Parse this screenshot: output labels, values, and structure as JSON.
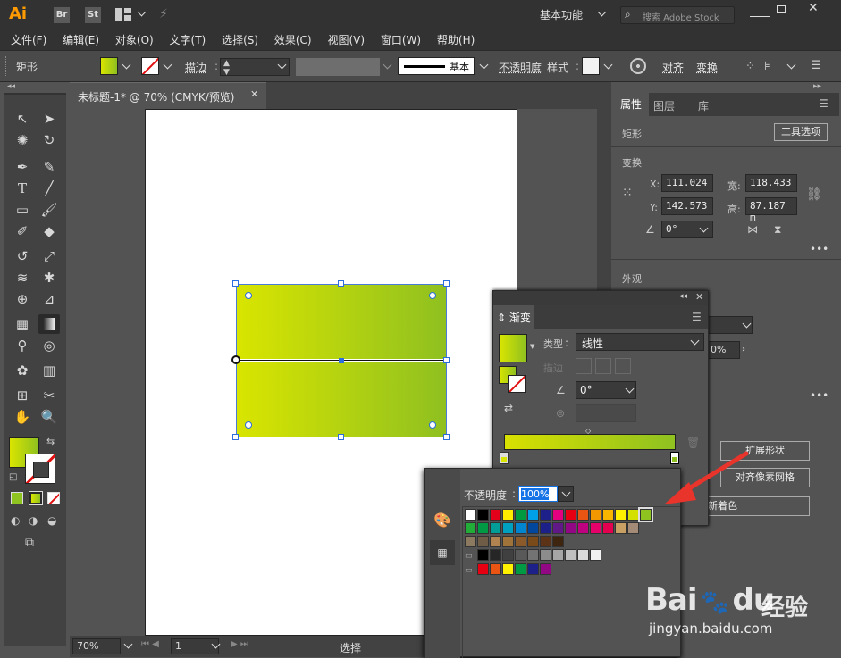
{
  "app": {
    "logo": "Ai",
    "br": "Br",
    "st": "St",
    "workspace": "基本功能",
    "stock_placeholder": "搜索 Adobe Stock"
  },
  "menu": [
    "文件(F)",
    "编辑(E)",
    "对象(O)",
    "文字(T)",
    "选择(S)",
    "效果(C)",
    "视图(V)",
    "窗口(W)",
    "帮助(H)"
  ],
  "control": {
    "object": "矩形",
    "stroke_label": "描边",
    "stroke_style": "基本",
    "opacity_label": "不透明度",
    "style_label": "样式",
    "align": "对齐",
    "transform": "变换"
  },
  "document": {
    "tab": "未标题-1* @ 70% (CMYK/预览)",
    "zoom": "70%",
    "page": "1",
    "status": "选择"
  },
  "properties": {
    "tabs": [
      "属性",
      "图层",
      "库"
    ],
    "object": "矩形",
    "tool_options": "工具选项",
    "transform": "变换",
    "x_label": "X:",
    "x": "111.024",
    "y_label": "Y:",
    "y": "142.573",
    "w_label": "宽:",
    "w": "118.433",
    "h_label": "高:",
    "h": "87.187 m",
    "angle": "0°",
    "appearance": "外观",
    "opacity_partial": "0%",
    "expand_shape": "扩展形状",
    "align_pixel": "对齐像素网格",
    "recolor": "新着色",
    "more": "•••"
  },
  "gradient": {
    "title": "渐变",
    "type_label": "类型",
    "type": "线性",
    "stroke_label": "描边",
    "angle": "0°"
  },
  "swatch_popup": {
    "opacity_label": "不透明度",
    "opacity": "100%"
  },
  "colors": {
    "grad_start": "#d9e500",
    "grad_end": "#8fc020",
    "accent": "#1473e6",
    "arrow": "#e8342b"
  },
  "swatches": {
    "row1": [
      "#ffffff",
      "#000000",
      "#e3001b",
      "#ffed00",
      "#009a3e",
      "#00a0e9",
      "#1d2088",
      "#e4007f",
      "#e60012",
      "#ea5514",
      "#f39800",
      "#f8b500",
      "#fff100",
      "#d4e100",
      "#8fc31f"
    ],
    "row2": [
      "#22ac38",
      "#009944",
      "#009e96",
      "#00a0c1",
      "#0086d1",
      "#00479d",
      "#1d2088",
      "#601986",
      "#920783",
      "#be0081",
      "#e5006a",
      "#e5004f",
      "#c9a063",
      "#a48b78"
    ],
    "row3": [
      "#8c7a60",
      "#6e5c46",
      "#b08350",
      "#a0733a",
      "#8b5a2b",
      "#7b4a19",
      "#5c3317",
      "#3e2510"
    ],
    "row4": [
      "#000000",
      "#262626",
      "#404040",
      "#595959",
      "#737373",
      "#8c8c8c",
      "#a6a6a6",
      "#bfbfbf",
      "#d9d9d9",
      "#f2f2f2"
    ],
    "row5": [
      "#e60012",
      "#ea5514",
      "#fff100",
      "#009944",
      "#1d2088",
      "#920783"
    ]
  },
  "watermark": {
    "brand": "Bai",
    "brand2": "du",
    "cn": "经验",
    "url": "jingyan.baidu.com"
  }
}
